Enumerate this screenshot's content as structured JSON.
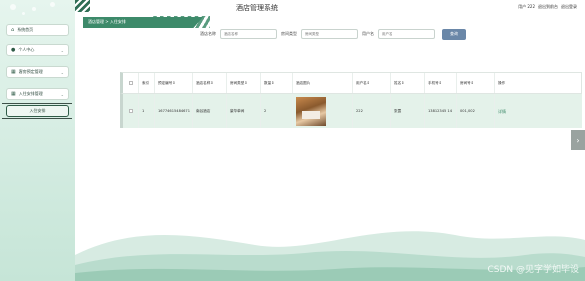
{
  "header": {
    "title": "酒店管理系统",
    "user_prefix": "用户 222",
    "logout_link": "退出到前台",
    "exit_link": "退出登录"
  },
  "breadcrumb": [
    "酒店管理",
    "入住安排"
  ],
  "sidebar": {
    "items": [
      {
        "label": "系统首页",
        "icon": "home-icon",
        "chevron": false
      },
      {
        "label": "个人中心",
        "icon": "person-icon",
        "chevron": true
      },
      {
        "label": "客房预定管理",
        "icon": "grid-icon",
        "chevron": true
      },
      {
        "label": "入住安排管理",
        "icon": "grid-icon",
        "chevron": true
      },
      {
        "label": "入住安排",
        "icon": "",
        "chevron": false
      }
    ]
  },
  "search": {
    "fields": [
      {
        "label": "酒店名称",
        "placeholder": "酒店名称"
      },
      {
        "label": "房间类型",
        "placeholder": "房间类型"
      },
      {
        "label": "用户名",
        "placeholder": "用户名"
      }
    ],
    "button": "查询"
  },
  "table": {
    "headers": [
      "",
      "索引",
      "预定编号",
      "酒店名称",
      "房间类型",
      "数量",
      "酒店图片",
      "用户名",
      "姓名",
      "手机号",
      "房间号",
      "操作"
    ],
    "sortable": [
      false,
      false,
      true,
      true,
      true,
      true,
      false,
      true,
      true,
      true,
      true,
      false
    ],
    "rows": [
      {
        "index": "1",
        "booking_no": "16774615484671",
        "hotel_name": "南谷酒店",
        "room_type": "豪华单间",
        "quantity": "2",
        "username": "222",
        "name": "张霞",
        "phone": "13812345 14",
        "room_no": "001,002",
        "action": "详情"
      }
    ]
  },
  "watermark": "CSDN @见字学如毕设",
  "colors": {
    "accent": "#3d8a6a",
    "search_button": "#6a87a8",
    "row_bg": "#e4f2ea"
  }
}
